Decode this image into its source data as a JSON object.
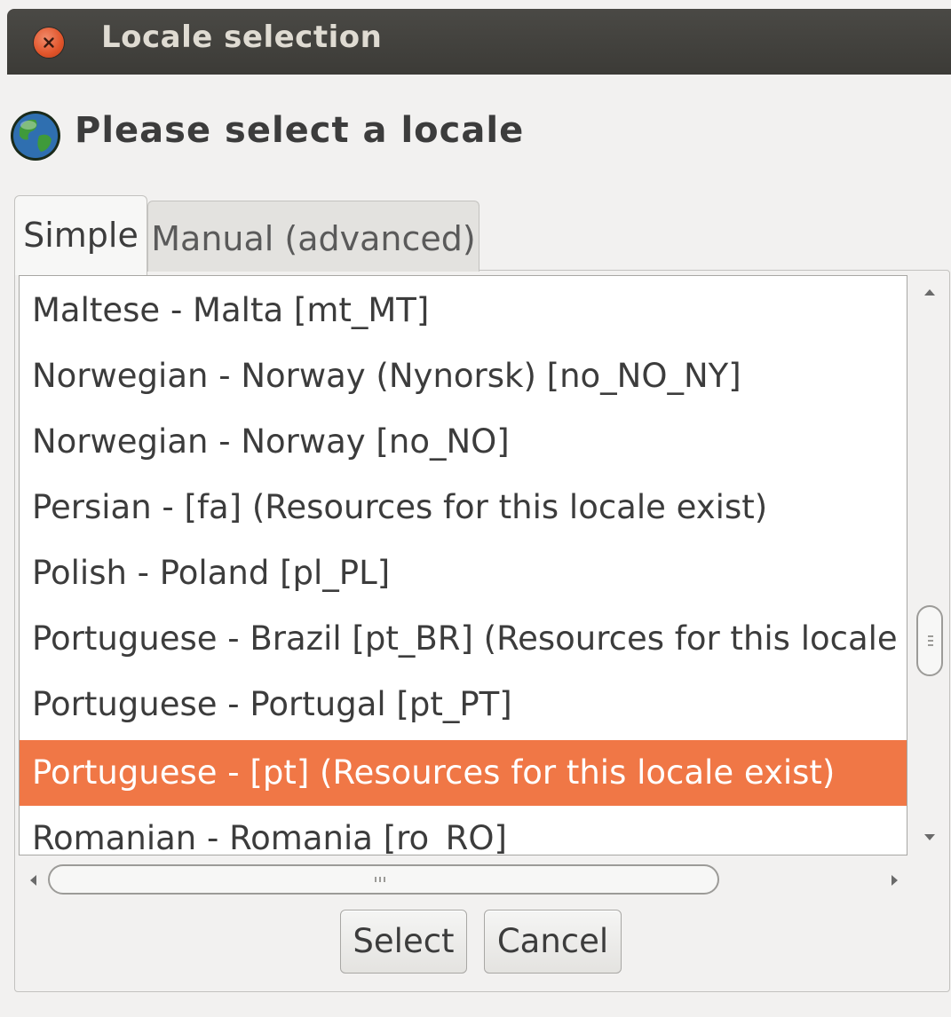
{
  "window": {
    "title": "Locale selection"
  },
  "heading": "Please select a locale",
  "tabs": [
    {
      "label": "Simple",
      "active": true
    },
    {
      "label": "Manual (advanced)",
      "active": false
    }
  ],
  "locale_list": {
    "items": [
      {
        "label": "Maltese - Malta [mt_MT]",
        "selected": false
      },
      {
        "label": "Norwegian - Norway (Nynorsk) [no_NO_NY]",
        "selected": false
      },
      {
        "label": "Norwegian - Norway [no_NO]",
        "selected": false
      },
      {
        "label": "Persian - [fa]  (Resources for this locale exist)",
        "selected": false
      },
      {
        "label": "Polish - Poland [pl_PL]",
        "selected": false
      },
      {
        "label": "Portuguese - Brazil [pt_BR]  (Resources for this locale exist)",
        "selected": false
      },
      {
        "label": "Portuguese - Portugal [pt_PT]",
        "selected": false
      },
      {
        "label": "Portuguese - [pt]  (Resources for this locale exist)",
        "selected": true
      },
      {
        "label": "Romanian - Romania [ro_RO]",
        "selected": false
      }
    ]
  },
  "buttons": {
    "select": "Select",
    "cancel": "Cancel"
  },
  "colors": {
    "selection": "#f07746",
    "titlebar": "#3c3b37",
    "close_button": "#e1542a"
  }
}
